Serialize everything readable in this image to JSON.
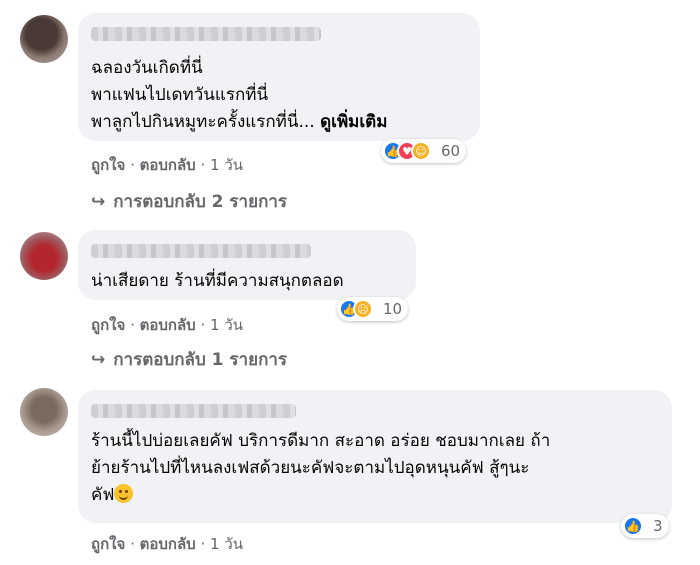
{
  "comments": [
    {
      "lines": [
        "ฉลองวันเกิดที่นี่",
        "พาแฟนไปเดทวันแรกที่นี่",
        "พาลูกไปกินหมูทะครั้งแรกที่นี่..."
      ],
      "see_more": "ดูเพิ่มเติม",
      "reaction_icons": [
        "like-icon",
        "love-icon",
        "care-icon"
      ],
      "reaction_count": "60",
      "like_label": "ถูกใจ",
      "reply_label": "ตอบกลับ",
      "time": "1 วัน",
      "replies_link": "การตอบกลับ 2 รายการ"
    },
    {
      "lines": [
        "น่าเสียดาย ร้านที่มีความสนุกตลอด"
      ],
      "reaction_icons": [
        "like-icon",
        "sad-icon"
      ],
      "reaction_count": "10",
      "like_label": "ถูกใจ",
      "reply_label": "ตอบกลับ",
      "time": "1 วัน",
      "replies_link": "การตอบกลับ 1 รายการ"
    },
    {
      "lines": [
        "ร้านนี้ไปบ่อยเลยคัฟ บริการดีมาก สะอาด อร่อย ชอบมากเลย ถ้า",
        "ย้ายร้านไปที่ไหนลงเฟสด้วยนะคัฟจะตามไปอุดหนุนคัฟ สู้ๆนะ",
        "คัฟ"
      ],
      "reaction_icons": [
        "like-icon"
      ],
      "reaction_count": "3",
      "like_label": "ถูกใจ",
      "reply_label": "ตอบกลับ",
      "time": "1 วัน"
    }
  ],
  "separator": "·",
  "reply_arrow": "↪",
  "colors": {
    "bubble": "#f0f2f5",
    "secondary_text": "#65676b",
    "like": "#1877f2",
    "love": "#f33e58",
    "care": "#f7b125"
  }
}
